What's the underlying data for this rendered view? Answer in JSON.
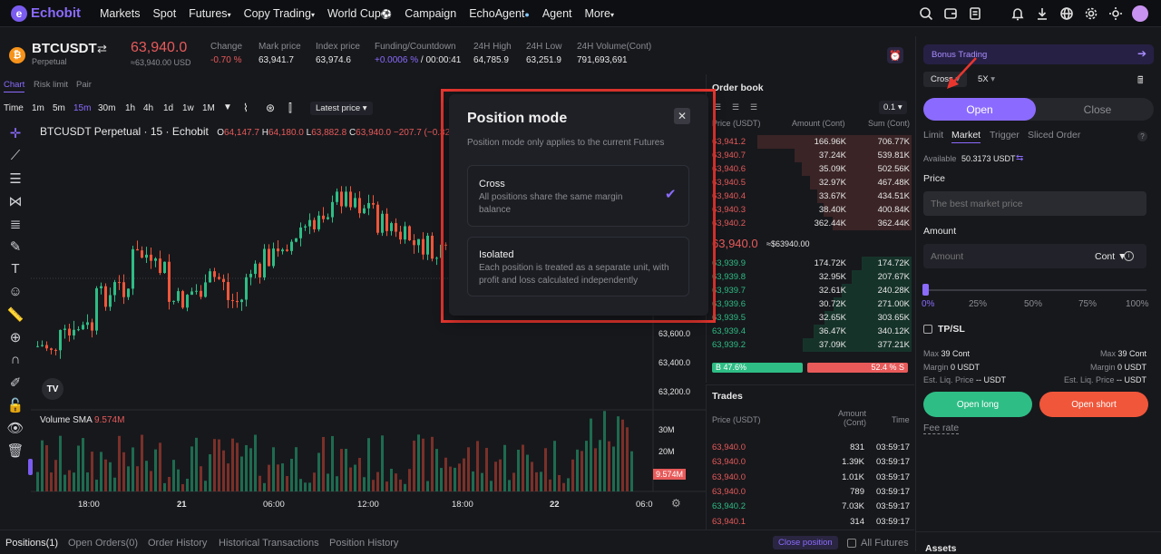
{
  "nav": {
    "brand": "Echobit",
    "items": [
      "Markets",
      "Spot",
      "Futures",
      "Copy Trading",
      "World Cup",
      "Campaign",
      "EchoAgent",
      "Agent",
      "More"
    ],
    "icons": [
      "search-icon",
      "wallet-icon",
      "orders-icon",
      "bell-icon",
      "download-icon",
      "globe-icon",
      "gear-icon",
      "theme-icon",
      "avatar"
    ]
  },
  "ticker": {
    "symbol": "BTCUSDT",
    "type": "Perpetual",
    "price": "63,940.0",
    "price_usd": "≈63,940.00 USD",
    "change_label": "Change",
    "change_value": "-0.70 %",
    "mark_label": "Mark price",
    "mark_value": "63,941.7",
    "index_label": "Index price",
    "index_value": "63,974.6",
    "funding_label": "Funding/Countdown",
    "funding_rate": "+0.0006 %",
    "funding_countdown": " / 00:00:41",
    "high_label": "24H High",
    "high_value": "64,785.9",
    "low_label": "24H Low",
    "low_value": "63,251.9",
    "vol_label": "24H Volume(Cont)",
    "vol_value": "791,693,691"
  },
  "chart_tabs": [
    "Chart",
    "Risk limit",
    "Pair"
  ],
  "timeframes": [
    "Time",
    "1m",
    "5m",
    "15m",
    "30m",
    "1h",
    "4h",
    "1d",
    "1w",
    "1M"
  ],
  "active_timeframe": "15m",
  "latest_price_select": "Latest price",
  "chart_legend": {
    "title": "BTCUSDT Perpetual · 15 · Echobit",
    "o_label": "O",
    "o": "64,147.7",
    "h_label": "H",
    "h": "64,180.0",
    "l_label": "L",
    "l": "63,882.8",
    "c_label": "C",
    "c": "63,940.0",
    "chg": "−207.7 (−0.32%)"
  },
  "price_axis": [
    "63,600.0",
    "63,400.0",
    "63,200.0"
  ],
  "volume": {
    "label": "Volume SMA",
    "value": "9.574M",
    "axis": [
      "30M",
      "20M"
    ],
    "current": "9.574M"
  },
  "time_axis": [
    "18:00",
    "21",
    "06:00",
    "12:00",
    "18:00",
    "22",
    "06:0"
  ],
  "orderbook": {
    "title": "Order book",
    "precision": "0.1",
    "col_price": "Price (USDT)",
    "col_amount": "Amount (Cont)",
    "col_sum": "Sum (Cont)",
    "asks": [
      {
        "price": "63,941.2",
        "amount": "166.96K",
        "sum": "706.77K",
        "depth": 1.0
      },
      {
        "price": "63,940.7",
        "amount": "37.24K",
        "sum": "539.81K",
        "depth": 0.76
      },
      {
        "price": "63,940.6",
        "amount": "35.09K",
        "sum": "502.56K",
        "depth": 0.71
      },
      {
        "price": "63,940.5",
        "amount": "32.97K",
        "sum": "467.48K",
        "depth": 0.66
      },
      {
        "price": "63,940.4",
        "amount": "33.67K",
        "sum": "434.51K",
        "depth": 0.61
      },
      {
        "price": "63,940.3",
        "amount": "38.40K",
        "sum": "400.84K",
        "depth": 0.57
      },
      {
        "price": "63,940.2",
        "amount": "362.44K",
        "sum": "362.44K",
        "depth": 0.51
      }
    ],
    "mid_price": "63,940.0",
    "mid_usd": "≈$63940.00",
    "bids": [
      {
        "price": "63,939.9",
        "amount": "174.72K",
        "sum": "174.72K",
        "depth": 0.46
      },
      {
        "price": "63,939.8",
        "amount": "32.95K",
        "sum": "207.67K",
        "depth": 0.55
      },
      {
        "price": "63,939.7",
        "amount": "32.61K",
        "sum": "240.28K",
        "depth": 0.64
      },
      {
        "price": "63,939.6",
        "amount": "30.72K",
        "sum": "271.00K",
        "depth": 0.72
      },
      {
        "price": "63,939.5",
        "amount": "32.65K",
        "sum": "303.65K",
        "depth": 0.8
      },
      {
        "price": "63,939.4",
        "amount": "36.47K",
        "sum": "340.12K",
        "depth": 0.9
      },
      {
        "price": "63,939.2",
        "amount": "37.09K",
        "sum": "377.21K",
        "depth": 1.0
      }
    ],
    "buy_pct_label": "B 47.6%",
    "sell_pct_label": "52.4 % S",
    "buy_ratio": 0.476
  },
  "trades": {
    "title": "Trades",
    "col_price": "Price (USDT)",
    "col_amount": "Amount",
    "col_amount_unit": "(Cont)",
    "col_time": "Time",
    "rows": [
      {
        "price": "63,940.0",
        "amount": "831",
        "time": "03:59:17",
        "side": "sell"
      },
      {
        "price": "63,940.0",
        "amount": "1.39K",
        "time": "03:59:17",
        "side": "sell"
      },
      {
        "price": "63,940.0",
        "amount": "1.01K",
        "time": "03:59:17",
        "side": "sell"
      },
      {
        "price": "63,940.0",
        "amount": "789",
        "time": "03:59:17",
        "side": "sell"
      },
      {
        "price": "63,940.2",
        "amount": "7.03K",
        "time": "03:59:17",
        "side": "buy"
      },
      {
        "price": "63,940.1",
        "amount": "314",
        "time": "03:59:17",
        "side": "sell"
      }
    ]
  },
  "bottom_tabs": [
    "Positions(1)",
    "Open Orders(0)",
    "Order History",
    "Historical Transactions",
    "Position History"
  ],
  "bottom_close_position": "Close position",
  "bottom_all_futures": "All Futures",
  "panel": {
    "bonus": "Bonus Trading",
    "margin_mode": "Cross",
    "leverage": "5X",
    "open": "Open",
    "close": "Close",
    "order_tabs": [
      "Limit",
      "Market",
      "Trigger",
      "Sliced Order"
    ],
    "available_label": "Available",
    "available_value": "50.3173 USDT",
    "price_label": "Price",
    "price_placeholder": "The best market price",
    "amount_label": "Amount",
    "amount_placeholder": "Amount",
    "amount_unit": "Cont",
    "slider_marks": [
      "0%",
      "25%",
      "50%",
      "75%",
      "100%"
    ],
    "slider_value": 0,
    "tpsl": "TP/SL",
    "max_label": "Max",
    "max_long": "39 Cont",
    "max_short": "39 Cont",
    "margin_label": "Margin",
    "margin_long": "0 USDT",
    "margin_short": "0 USDT",
    "liq_label": "Est. Liq. Price",
    "liq_long": "-- USDT",
    "liq_short": "-- USDT",
    "open_long": "Open long",
    "open_short": "Open short",
    "fee_rate": "Fee rate",
    "assets": "Assets"
  },
  "modal": {
    "title": "Position mode",
    "subtitle": "Position mode only applies to the current Futures",
    "options": [
      {
        "name": "Cross",
        "desc": "All positions share the same margin balance",
        "selected": true
      },
      {
        "name": "Isolated",
        "desc": "Each position is treated as a separate unit, with profit and loss calculated independently",
        "selected": false
      }
    ]
  },
  "colors": {
    "accent": "#8b6bff",
    "up": "#2ebd85",
    "down": "#e85a5a",
    "highlight": "#e8362f"
  }
}
